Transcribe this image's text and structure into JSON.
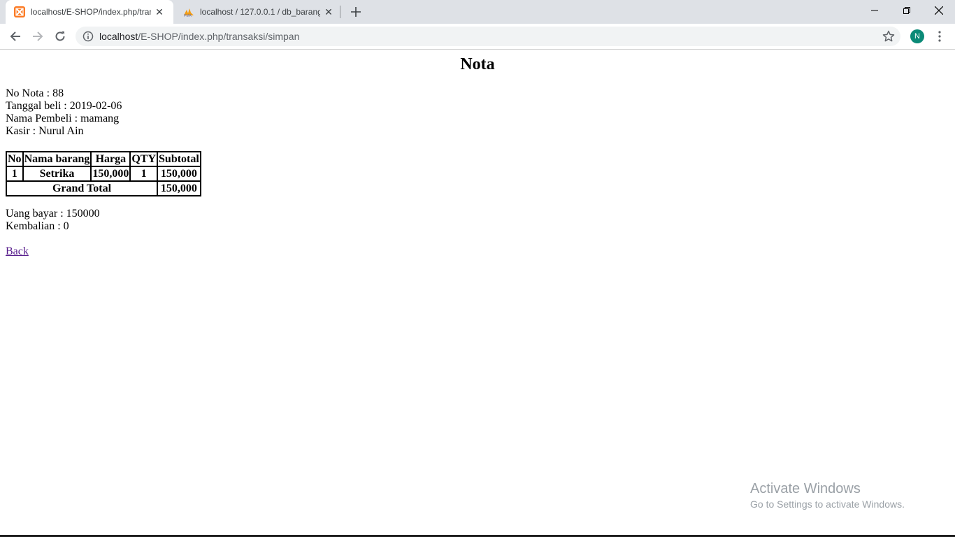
{
  "browser": {
    "tabs": [
      {
        "title": "localhost/E-SHOP/index.php/tran",
        "icon": "xampp-icon",
        "active": true
      },
      {
        "title": "localhost / 127.0.0.1 / db_barang",
        "icon": "phpmyadmin-icon",
        "active": false
      }
    ],
    "url_host": "localhost",
    "url_path": "/E-SHOP/index.php/transaksi/simpan",
    "profile_initial": "N",
    "profile_color": "#0b8a77"
  },
  "page": {
    "title": "Nota",
    "info": {
      "no_nota": "No Nota : 88",
      "tanggal": "Tanggal beli : 2019-02-06",
      "pembeli": "Nama Pembeli : mamang",
      "kasir": "Kasir : Nurul Ain"
    },
    "table": {
      "headers": [
        "No",
        "Nama barang",
        "Harga",
        "QTY",
        "Subtotal"
      ],
      "rows": [
        [
          "1",
          "Setrika",
          "150,000",
          "1",
          "150,000"
        ]
      ],
      "grand_total_label": "Grand Total",
      "grand_total_value": "150,000"
    },
    "payment": {
      "uang_bayar": "Uang bayar : 150000",
      "kembalian": "Kembalian : 0"
    },
    "back_label": "Back"
  },
  "watermark": {
    "line1": "Activate Windows",
    "line2": "Go to Settings to activate Windows."
  }
}
